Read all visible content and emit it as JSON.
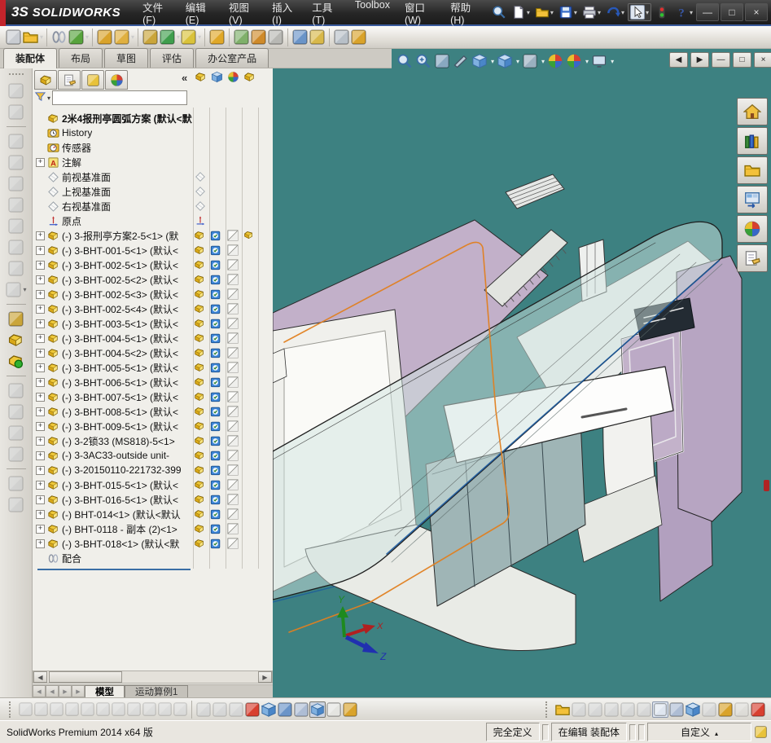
{
  "app": {
    "logo_mark": "3S",
    "logo": "SOLIDWORKS"
  },
  "titlebar": {
    "menus": [
      "文件(F)",
      "编辑(E)",
      "视图(V)",
      "插入(I)",
      "工具(T)",
      "Toolbox",
      "窗口(W)",
      "帮助(H)"
    ],
    "window_buttons": [
      {
        "name": "minimize-window",
        "glyph": "—"
      },
      {
        "name": "maximize-window",
        "glyph": "□"
      },
      {
        "name": "close-window",
        "glyph": "×"
      }
    ]
  },
  "quick_toolbar": [
    {
      "n": "search",
      "t": "mag"
    },
    {
      "n": "new-document",
      "t": "doc",
      "d": 1
    },
    {
      "n": "open-document",
      "t": "folder",
      "d": 1
    },
    {
      "n": "save",
      "t": "save",
      "d": 1
    },
    {
      "n": "print",
      "t": "print",
      "d": 1
    },
    {
      "n": "undo",
      "t": "undo",
      "d": 1
    },
    {
      "n": "select",
      "t": "cursor",
      "d": 1,
      "boxed": 1
    },
    {
      "n": "solidworks-rx",
      "t": "traffic"
    },
    {
      "n": "help",
      "t": "help",
      "d": 1
    }
  ],
  "assembly_toolbar": [
    {
      "n": "edit-component",
      "t": "gen",
      "c": "#c9ccd1"
    },
    {
      "n": "insert-components",
      "t": "folder",
      "d": 1
    },
    {
      "n": "mate",
      "t": "clips",
      "s": 1
    },
    {
      "n": "component-pattern",
      "t": "gen",
      "c": "#57a33c",
      "d": 1
    },
    {
      "n": "smart-fasteners",
      "t": "gen",
      "c": "#d9a32b",
      "s": 1
    },
    {
      "n": "move-component",
      "t": "gen",
      "c": "#e0b040",
      "d": 1
    },
    {
      "n": "show-hidden-components",
      "t": "gen",
      "c": "#caa53a",
      "s": 1
    },
    {
      "n": "assembly-features",
      "t": "gen",
      "c": "#3f9e4d",
      "d": 1
    },
    {
      "n": "reference-geometry",
      "t": "gen",
      "c": "#d9c23a",
      "d": 1
    },
    {
      "n": "new-motion-study",
      "t": "gen",
      "c": "#e0a828",
      "s": 1
    },
    {
      "n": "bill-of-materials",
      "t": "gen",
      "c": "#7fb06a",
      "s": 1
    },
    {
      "n": "exploded-view",
      "t": "gen",
      "c": "#cf8a2a"
    },
    {
      "n": "explode-line-sketch",
      "t": "gen",
      "c": "#b8b8b4"
    },
    {
      "n": "instant3d",
      "t": "gen",
      "c": "#6a94c8",
      "s": 1
    },
    {
      "n": "interference-detection",
      "t": "gen",
      "c": "#d8b84a"
    },
    {
      "n": "take-snapshot",
      "t": "gen",
      "c": "#b8c0c8",
      "s": 1
    },
    {
      "n": "measure",
      "t": "gen",
      "c": "#d9a32b"
    }
  ],
  "command_tabs": {
    "active": 0,
    "tabs": [
      "装配体",
      "布局",
      "草图",
      "评估",
      "办公室产品"
    ]
  },
  "hud_toolbar": [
    {
      "n": "zoom-to-fit",
      "t": "mag"
    },
    {
      "n": "zoom-to-area",
      "t": "magplus"
    },
    {
      "n": "previous-view",
      "t": "gen",
      "c": "#88a8c0"
    },
    {
      "n": "section-view",
      "t": "knife"
    },
    {
      "n": "view-orientation",
      "t": "cube",
      "d": 1
    },
    {
      "n": "display-style",
      "t": "cube",
      "d": 1
    },
    {
      "n": "hide-show-items",
      "t": "gen",
      "c": "#9ab0c0",
      "d": 1
    },
    {
      "n": "edit-appearance",
      "t": "sphere"
    },
    {
      "n": "apply-scene",
      "t": "sphere",
      "d": 1
    },
    {
      "n": "view-settings",
      "t": "monitor",
      "d": 1
    }
  ],
  "doc_window_controls": [
    {
      "name": "tile-left",
      "glyph": "◀"
    },
    {
      "name": "tile-right",
      "glyph": "▶"
    },
    {
      "name": "minimize-document",
      "glyph": "—"
    },
    {
      "name": "restore-document",
      "glyph": "□"
    },
    {
      "name": "close-document",
      "glyph": "×"
    }
  ],
  "left_toolbar": [
    {
      "n": "filter-tool",
      "t": "gen",
      "c": "#c4c8cc",
      "dim": 1
    },
    {
      "n": "copy-with-mates",
      "t": "gen",
      "c": "#c4c8cc",
      "dim": 1
    },
    {
      "n": "component-properties",
      "t": "gen",
      "c": "#c4c8cc",
      "dim": 1,
      "s": 1
    },
    {
      "n": "insert-component-tool",
      "t": "gen",
      "c": "#c4c8cc",
      "dim": 1
    },
    {
      "n": "edit-part",
      "t": "gen",
      "c": "#c4c8cc",
      "dim": 1
    },
    {
      "n": "mate-tool",
      "t": "gen",
      "c": "#c4c8cc",
      "dim": 1
    },
    {
      "n": "move-component-tool",
      "t": "gen",
      "c": "#c4c8cc",
      "dim": 1
    },
    {
      "n": "rotate-component-tool",
      "t": "gen",
      "c": "#c4c8cc",
      "dim": 1
    },
    {
      "n": "smart-mates",
      "t": "gen",
      "c": "#c4c8cc",
      "dim": 1
    },
    {
      "n": "component-drop",
      "t": "gen",
      "c": "#c4c8cc",
      "dim": 1,
      "d": 1
    },
    {
      "n": "lock-mate",
      "t": "gen",
      "c": "#caa53a",
      "s": 1
    },
    {
      "n": "isolate",
      "t": "part"
    },
    {
      "n": "large-design-review",
      "t": "partgreen"
    },
    {
      "n": "pattern-driven",
      "t": "gen",
      "c": "#c4c8cc",
      "dim": 1,
      "s": 1
    },
    {
      "n": "make-subassembly",
      "t": "gen",
      "c": "#c4c8cc",
      "dim": 1
    },
    {
      "n": "dissolve-subassembly",
      "t": "gen",
      "c": "#c4c8cc",
      "dim": 1
    },
    {
      "n": "reload",
      "t": "gen",
      "c": "#c4c8cc",
      "dim": 1
    },
    {
      "n": "no-preview",
      "t": "gen",
      "c": "#c4c8cc",
      "dim": 1,
      "s": 1
    },
    {
      "n": "hide-component",
      "t": "gen",
      "c": "#c4c8cc",
      "dim": 1
    }
  ],
  "feature_panel": {
    "header_tabs": [
      {
        "n": "featuremanager-tab",
        "t": "part"
      },
      {
        "n": "propertymanager-tab",
        "t": "handdoc"
      },
      {
        "n": "configurationmanager-tab",
        "t": "gen",
        "c": "#e8c23a"
      },
      {
        "n": "dimxpert-tab",
        "t": "sphere"
      }
    ],
    "collapse_glyph": "«",
    "display_header": [
      {
        "n": "hide-show-column",
        "t": "part"
      },
      {
        "n": "display-mode-column",
        "t": "cube"
      },
      {
        "n": "appearance-column",
        "t": "sphere"
      },
      {
        "n": "transparency-column",
        "t": "part"
      }
    ],
    "tree": {
      "root_label": "2米4报刑亭圆弧方案",
      "root_suffix": "(默认<默认",
      "items": [
        {
          "e": false,
          "i": "clock",
          "t": "History",
          "d": ""
        },
        {
          "e": false,
          "i": "sensor",
          "t": "传感器",
          "d": ""
        },
        {
          "e": true,
          "i": "noteA",
          "t": "注解",
          "d": ""
        },
        {
          "e": false,
          "i": "plane",
          "t": "前视基准面",
          "d": "plane"
        },
        {
          "e": false,
          "i": "plane",
          "t": "上视基准面",
          "d": "plane"
        },
        {
          "e": false,
          "i": "plane",
          "t": "右视基准面",
          "d": "plane"
        },
        {
          "e": false,
          "i": "origin",
          "t": "原点",
          "d": "origin"
        },
        {
          "e": true,
          "i": "part",
          "t": "(-) 3-报刑亭方案2-5<1> (默",
          "d": "comp4"
        },
        {
          "e": true,
          "i": "part",
          "t": "(-) 3-BHT-001-5<1> (默认<",
          "d": "comp"
        },
        {
          "e": true,
          "i": "part",
          "t": "(-) 3-BHT-002-5<1> (默认<",
          "d": "comp"
        },
        {
          "e": true,
          "i": "part",
          "t": "(-) 3-BHT-002-5<2> (默认<",
          "d": "comp"
        },
        {
          "e": true,
          "i": "part",
          "t": "(-) 3-BHT-002-5<3> (默认<",
          "d": "comp"
        },
        {
          "e": true,
          "i": "part",
          "t": "(-) 3-BHT-002-5<4> (默认<",
          "d": "comp"
        },
        {
          "e": true,
          "i": "part",
          "t": "(-) 3-BHT-003-5<1> (默认<",
          "d": "comp"
        },
        {
          "e": true,
          "i": "part",
          "t": "(-) 3-BHT-004-5<1> (默认<",
          "d": "comp"
        },
        {
          "e": true,
          "i": "part",
          "t": "(-) 3-BHT-004-5<2> (默认<",
          "d": "comp"
        },
        {
          "e": true,
          "i": "part",
          "t": "(-) 3-BHT-005-5<1> (默认<",
          "d": "comp"
        },
        {
          "e": true,
          "i": "part",
          "t": "(-) 3-BHT-006-5<1> (默认<",
          "d": "comp"
        },
        {
          "e": true,
          "i": "part",
          "t": "(-) 3-BHT-007-5<1> (默认<",
          "d": "comp"
        },
        {
          "e": true,
          "i": "part",
          "t": "(-) 3-BHT-008-5<1> (默认<",
          "d": "comp"
        },
        {
          "e": true,
          "i": "part",
          "t": "(-) 3-BHT-009-5<1> (默认<",
          "d": "comp"
        },
        {
          "e": true,
          "i": "part",
          "t": "(-) 3-2锁33 (MS818)-5<1>",
          "d": "comp"
        },
        {
          "e": true,
          "i": "part",
          "t": "(-) 3-3AC33-outside unit-",
          "d": "comp"
        },
        {
          "e": true,
          "i": "part",
          "t": "(-) 3-20150110-221732-399",
          "d": "comp"
        },
        {
          "e": true,
          "i": "part",
          "t": "(-) 3-BHT-015-5<1> (默认<",
          "d": "comp"
        },
        {
          "e": true,
          "i": "part",
          "t": "(-) 3-BHT-016-5<1> (默认<",
          "d": "comp"
        },
        {
          "e": true,
          "i": "part",
          "t": "(-) BHT-014<1> (默认<默认",
          "d": "comp"
        },
        {
          "e": true,
          "i": "part",
          "t": "(-) BHT-0118 - 副本 (2)<1>",
          "d": "comp"
        },
        {
          "e": true,
          "i": "part",
          "t": "(-) 3-BHT-018<1> (默认<默",
          "d": "comp"
        },
        {
          "e": false,
          "i": "clips",
          "t": "配合",
          "d": ""
        }
      ]
    }
  },
  "model_tabs": {
    "nav": [
      "◀",
      "◀",
      "▶",
      "▶"
    ],
    "tabs": [
      "模型",
      "运动算例1"
    ],
    "active": 0
  },
  "viewport": {
    "bg": "#3d8181",
    "task_pane": [
      {
        "n": "solidworks-resources",
        "t": "home"
      },
      {
        "n": "design-library",
        "t": "books"
      },
      {
        "n": "file-explorer",
        "t": "folder"
      },
      {
        "n": "view-palette",
        "t": "palette"
      },
      {
        "n": "appearances-scenes",
        "t": "sphere"
      },
      {
        "n": "custom-properties",
        "t": "handdoc"
      }
    ],
    "triad": {
      "x": "X",
      "y": "Y",
      "z": "Z"
    }
  },
  "bottom_toolbar": {
    "left": [
      {
        "n": "sketch-point",
        "t": "gen",
        "c": "#d2d5d9",
        "dim": 1
      },
      {
        "n": "sketch-circle",
        "t": "gen",
        "c": "#d2d5d9",
        "dim": 1
      },
      {
        "n": "sketch-line",
        "t": "gen",
        "c": "#d2d5d9",
        "dim": 1
      },
      {
        "n": "sketch-polygon",
        "t": "gen",
        "c": "#d2d5d9",
        "dim": 1
      },
      {
        "n": "sketch-trim",
        "t": "gen",
        "c": "#d2d5d9",
        "dim": 1
      },
      {
        "n": "sketch-angle",
        "t": "gen",
        "c": "#d2d5d9",
        "dim": 1
      },
      {
        "n": "relation-tangent",
        "t": "gen",
        "c": "#d2d5d9",
        "dim": 1
      },
      {
        "n": "relation-coincident",
        "t": "gen",
        "c": "#d2d5d9",
        "dim": 1
      },
      {
        "n": "relation-parallel",
        "t": "gen",
        "c": "#d2d5d9",
        "dim": 1
      },
      {
        "n": "relation-perpendicular",
        "t": "gen",
        "c": "#d2d5d9",
        "dim": 1
      },
      {
        "n": "relation-fix",
        "t": "gen",
        "c": "#d2d5d9",
        "dim": 1
      }
    ],
    "middle": [
      {
        "n": "dimension",
        "t": "gen",
        "c": "#c8ccd2",
        "dim": 1
      },
      {
        "n": "grid",
        "t": "gen",
        "c": "#c8ccd2",
        "dim": 1
      },
      {
        "n": "angle-snap",
        "t": "gen",
        "c": "#c8ccd2",
        "dim": 1
      },
      {
        "n": "collision-detection",
        "t": "gen",
        "c": "#d84030"
      },
      {
        "n": "view-cube",
        "t": "cube"
      },
      {
        "n": "temporary-axes",
        "t": "gen",
        "c": "#6a94c8"
      },
      {
        "n": "annotation-table",
        "t": "gen",
        "c": "#aebdd4"
      },
      {
        "n": "shaded-with-edges",
        "t": "cube",
        "pressed": 1
      },
      {
        "n": "wireframe",
        "t": "gen",
        "c": "#e4e4e0"
      },
      {
        "n": "measure-tool",
        "t": "gen",
        "c": "#d9a32b"
      }
    ],
    "right": [
      {
        "n": "annotation-folder",
        "t": "folder"
      },
      {
        "n": "note-add",
        "t": "gen",
        "c": "#c8ccd2",
        "dim": 1
      },
      {
        "n": "note-link",
        "t": "gen",
        "c": "#c8ccd2",
        "dim": 1
      },
      {
        "n": "lock-note",
        "t": "gen",
        "c": "#c8ccd2",
        "dim": 1
      },
      {
        "n": "hide-annotation",
        "t": "gen",
        "c": "#c8ccd2",
        "dim": 1
      },
      {
        "n": "belt-chain",
        "t": "gen",
        "c": "#c8ccd2",
        "dim": 1
      },
      {
        "n": "split-horizontal",
        "t": "gen",
        "c": "#dfe6f0",
        "boxed": 1
      },
      {
        "n": "split-table",
        "t": "gen",
        "c": "#aebdd4"
      },
      {
        "n": "shaded-cube",
        "t": "cube"
      },
      {
        "n": "hidden-lines",
        "t": "gen",
        "c": "#c8ccd2",
        "dim": 1
      },
      {
        "n": "measure-2",
        "t": "gen",
        "c": "#d9a32b"
      },
      {
        "n": "draft-cube",
        "t": "gen",
        "c": "#d8d8d4",
        "dim": 1
      },
      {
        "n": "collision-2",
        "t": "gen",
        "c": "#d84030"
      }
    ]
  },
  "statusbar": {
    "product": "SolidWorks Premium 2014 x64 版",
    "cells": [
      "完全定义",
      "在编辑 装配体",
      "自定义"
    ],
    "custom_arrow": "▴"
  }
}
